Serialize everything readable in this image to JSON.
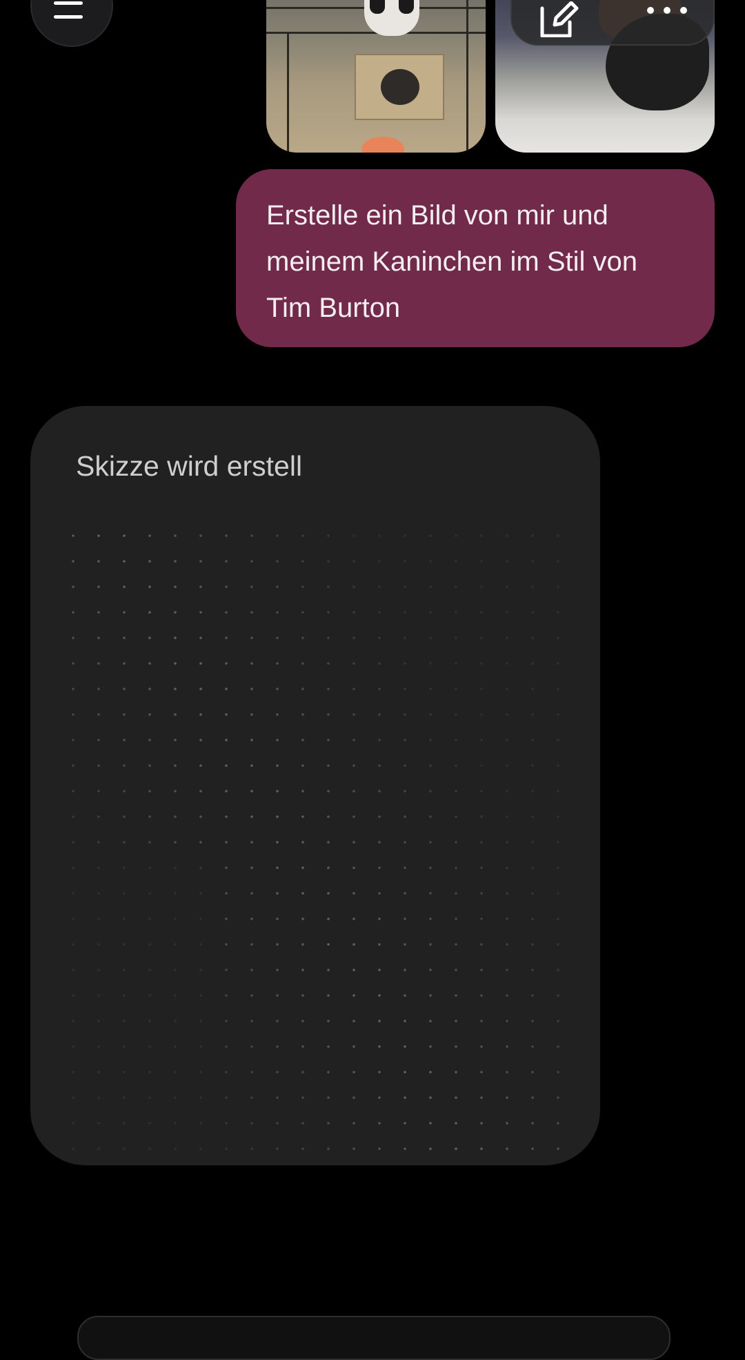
{
  "header": {
    "menu_icon": "hamburger-menu-icon",
    "actions": {
      "edit_icon": "compose-edit-icon",
      "more_icon": "more-horizontal-icon"
    }
  },
  "attachments": [
    {
      "kind": "photo",
      "subject": "rabbit-cage-photo"
    },
    {
      "kind": "photo",
      "subject": "rabbit-on-blanket-photo"
    }
  ],
  "conversation": {
    "user_message": "Erstelle ein Bild von mir und meinem Kaninchen im Stil von Tim Burton",
    "assistant_status": "Skizze wird erstell"
  },
  "colors": {
    "background": "#000000",
    "user_bubble": "#722a4b",
    "card": "#212121",
    "status_text": "#cfcfcf"
  }
}
